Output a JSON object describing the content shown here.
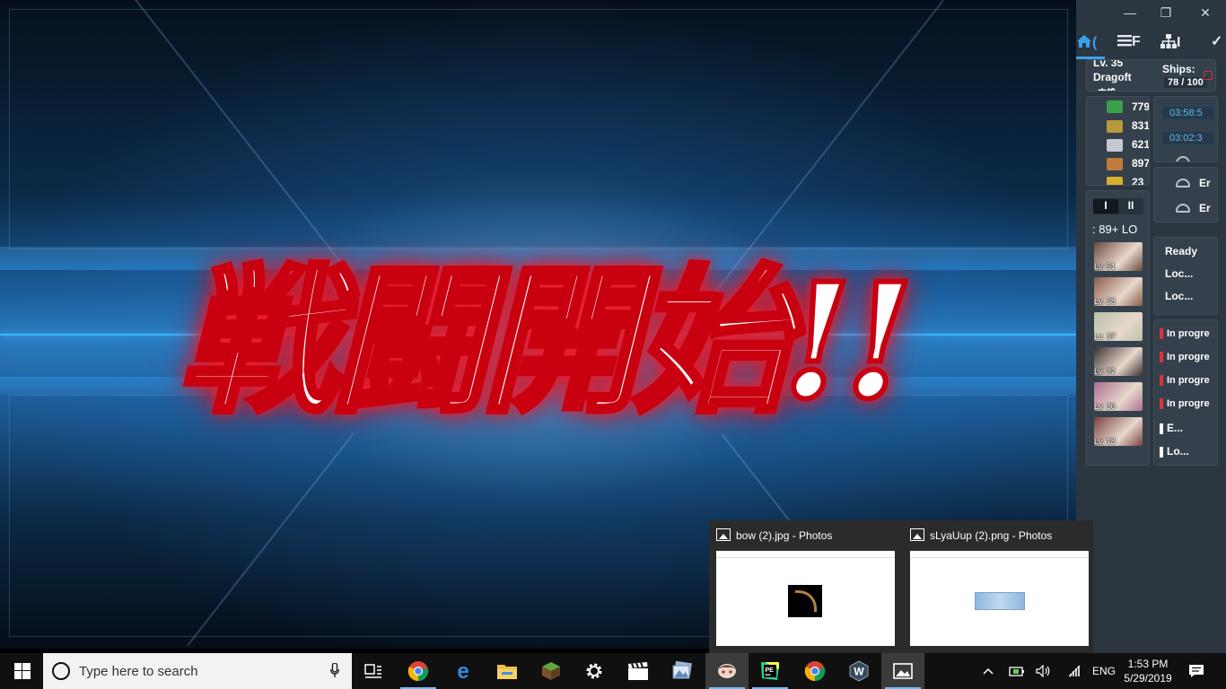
{
  "game": {
    "banner_text": "戦闘開始!!"
  },
  "panel": {
    "window_controls": [
      "—",
      "❐",
      "✕"
    ],
    "tabs": [
      "(",
      "F",
      "I",
      "✓"
    ],
    "admiral": {
      "level": "Lv. 35",
      "name": "Dragoft",
      "rank": "中将",
      "ships_label": "Ships:",
      "ships_count": "78 / 100"
    },
    "resources": [
      {
        "name": "fuel",
        "value": "779",
        "color": "#3aa04a"
      },
      {
        "name": "ammo",
        "value": "831",
        "color": "#b89a3a"
      },
      {
        "name": "steel",
        "value": "621",
        "color": "#c8c8d0"
      },
      {
        "name": "bauxite",
        "value": "897",
        "color": "#c07a3a"
      },
      {
        "name": "bucket",
        "value": "23",
        "color": "#d8b030"
      }
    ],
    "timers": [
      "03:58:5",
      "03:02:3"
    ],
    "docks": [
      "Er",
      "Er"
    ],
    "fleet_tabs": [
      "I",
      "II"
    ],
    "fleet_summary": ": 89+ LO",
    "ships": [
      {
        "level": "Lv. 51",
        "color": "#6a4a3a"
      },
      {
        "level": "Lv. 38",
        "color": "#8a5a4a"
      },
      {
        "level": "Lv. 37",
        "color": "#b8c0a8"
      },
      {
        "level": "Lv. 32",
        "color": "#3a3030"
      },
      {
        "level": "Lv. 30",
        "color": "#a87090"
      },
      {
        "level": "Lv. 18",
        "color": "#7a4040"
      }
    ],
    "fleet_status": [
      "Ready",
      "Loc...",
      "Loc..."
    ],
    "expeditions": [
      {
        "text": "In progre",
        "color": "#e0303a"
      },
      {
        "text": "In progre",
        "color": "#e0303a"
      },
      {
        "text": "In progre",
        "color": "#e0303a"
      },
      {
        "text": "In progre",
        "color": "#e0303a"
      },
      {
        "text": "E...",
        "color": "#ffffff"
      },
      {
        "text": "Lo...",
        "color": "#ffffff"
      }
    ]
  },
  "thumbnails": [
    {
      "title": "bow (2).jpg - Photos"
    },
    {
      "title": "sLyaUup (2).png - Photos"
    }
  ],
  "taskbar": {
    "search_placeholder": "Type here to search",
    "apps": [
      "task-view",
      "chrome",
      "edge",
      "file-explorer",
      "minecraft",
      "settings",
      "movie-maker",
      "photos-gallery",
      "kancolle",
      "pycharm",
      "chrome",
      "wallpaper",
      "photos"
    ],
    "tray": {
      "lang": "ENG",
      "time": "1:53 PM",
      "date": "5/29/2019"
    }
  }
}
